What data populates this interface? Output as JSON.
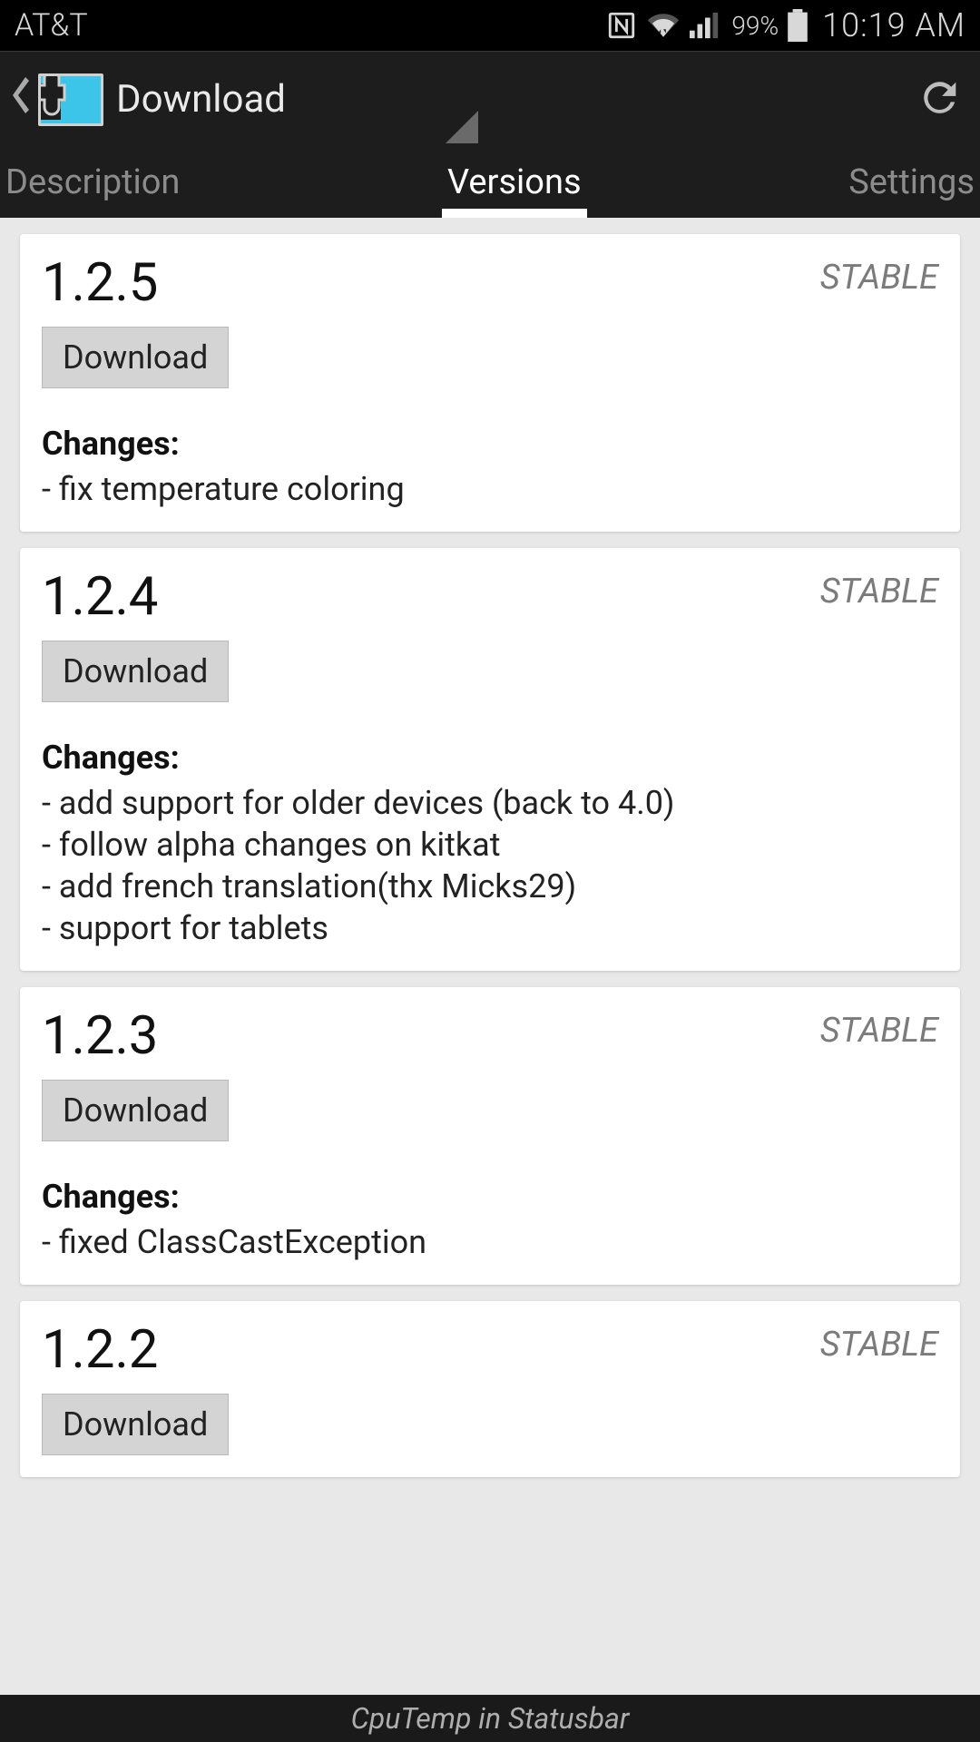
{
  "status": {
    "carrier": "AT&T",
    "battery_pct": "99%",
    "time": "10:19 AM"
  },
  "actionbar": {
    "title": "Download"
  },
  "tabs": {
    "description": "Description",
    "versions": "Versions",
    "settings": "Settings"
  },
  "common": {
    "download_label": "Download",
    "changes_heading": "Changes:"
  },
  "versions": [
    {
      "version": "1.2.5",
      "channel": "STABLE",
      "changes": "- fix temperature coloring"
    },
    {
      "version": "1.2.4",
      "channel": "STABLE",
      "changes": "- add support for older devices (back to 4.0)\n- follow alpha changes on kitkat\n- add french translation(thx Micks29)\n- support for tablets"
    },
    {
      "version": "1.2.3",
      "channel": "STABLE",
      "changes": "- fixed ClassCastException"
    },
    {
      "version": "1.2.2",
      "channel": "STABLE",
      "changes": ""
    }
  ],
  "footer": {
    "module_name": "CpuTemp in Statusbar"
  }
}
